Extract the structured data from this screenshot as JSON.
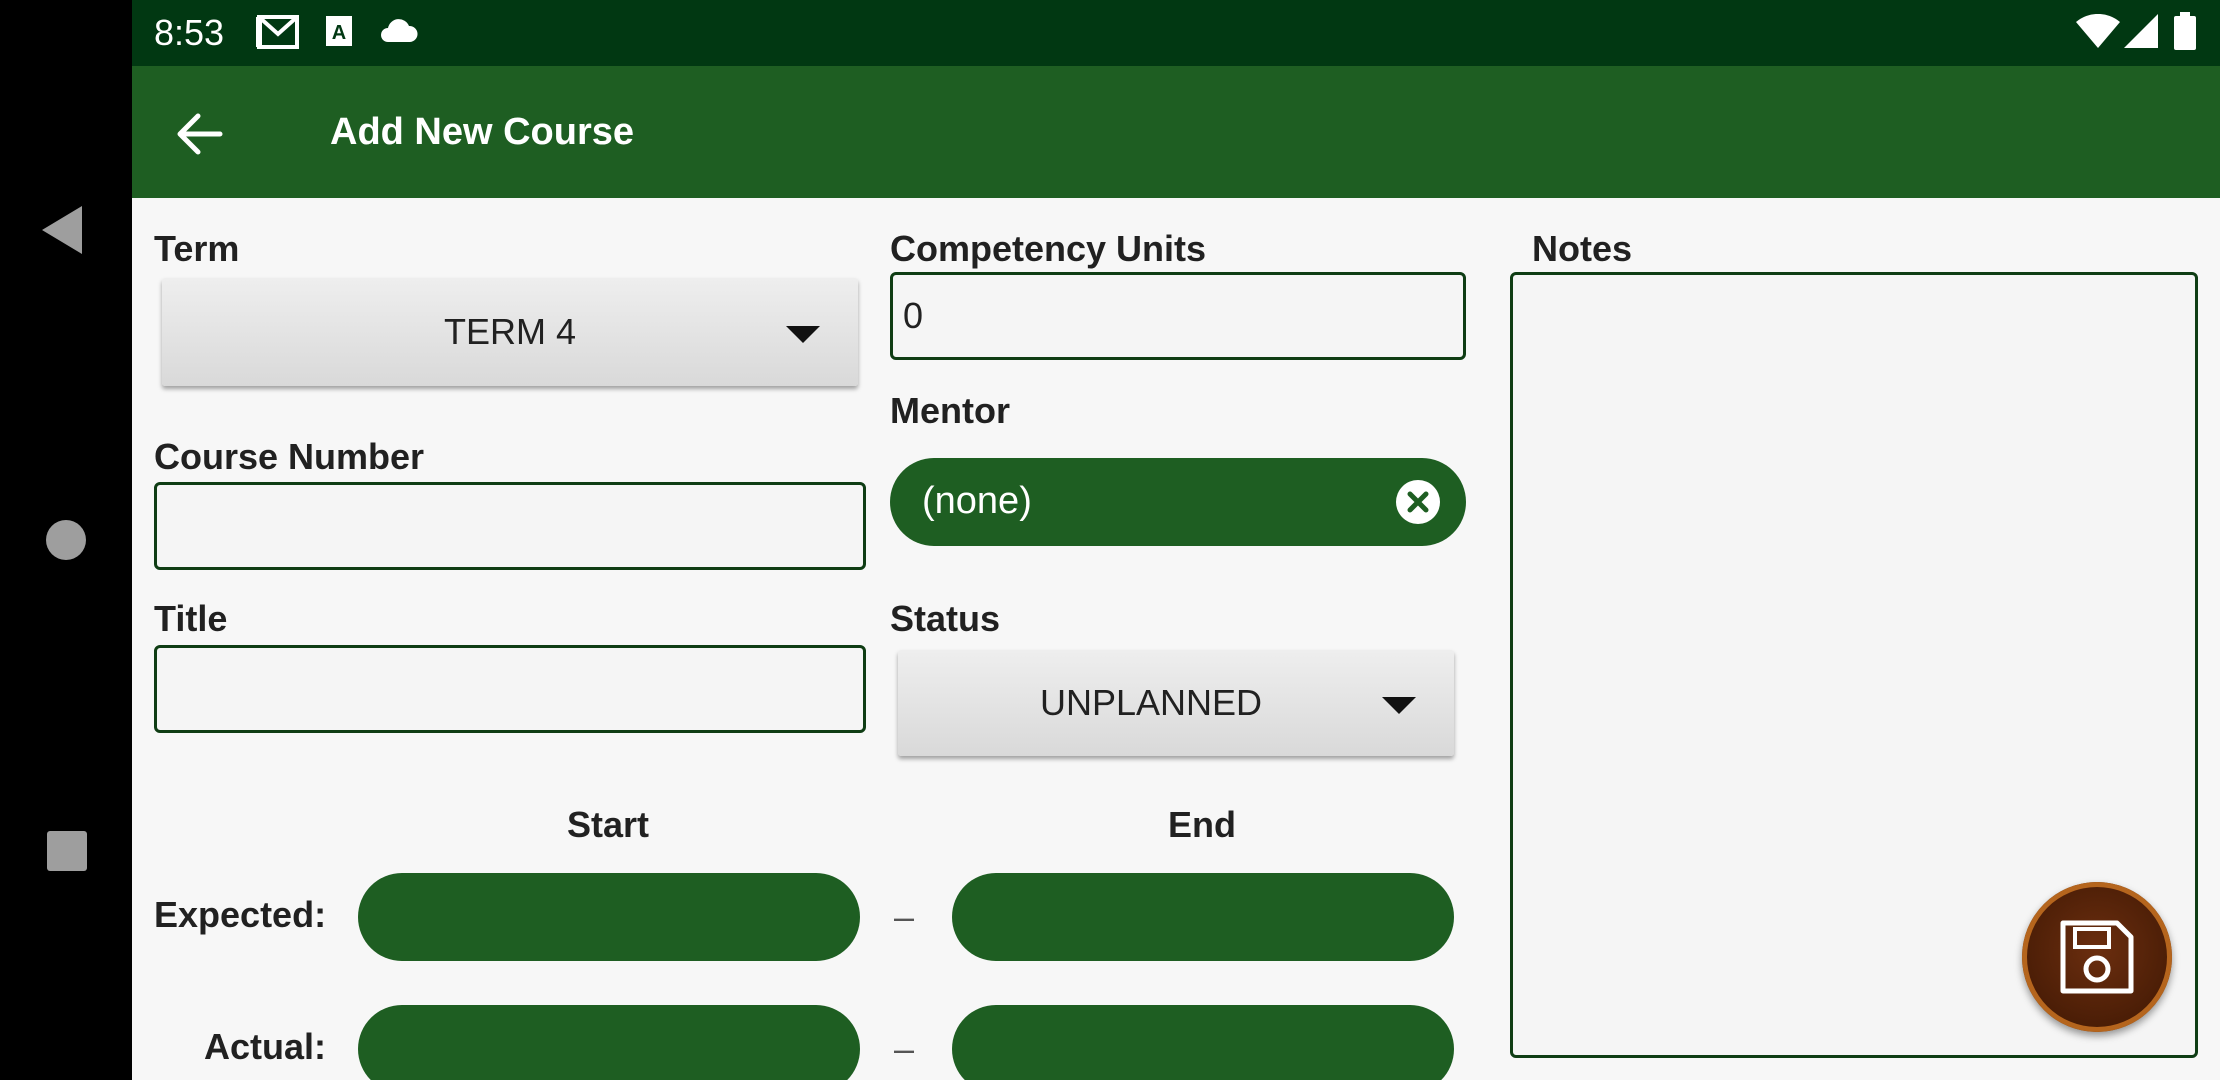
{
  "status_bar": {
    "time": "8:53"
  },
  "toolbar": {
    "title": "Add New Course"
  },
  "form": {
    "term": {
      "label": "Term",
      "value": "TERM 4"
    },
    "competency_units": {
      "label": "Competency Units",
      "value": "0"
    },
    "notes": {
      "label": "Notes",
      "value": ""
    },
    "mentor": {
      "label": "Mentor",
      "value": "(none)"
    },
    "course_number": {
      "label": "Course Number",
      "value": ""
    },
    "title": {
      "label": "Title",
      "value": ""
    },
    "status": {
      "label": "Status",
      "value": "UNPLANNED"
    },
    "dates": {
      "start_header": "Start",
      "end_header": "End",
      "expected_label": "Expected:",
      "actual_label": "Actual:",
      "separator": "–"
    }
  },
  "colors": {
    "primary": "#1e5e22",
    "status_bar": "#013812",
    "fab": "#4a1d06"
  }
}
